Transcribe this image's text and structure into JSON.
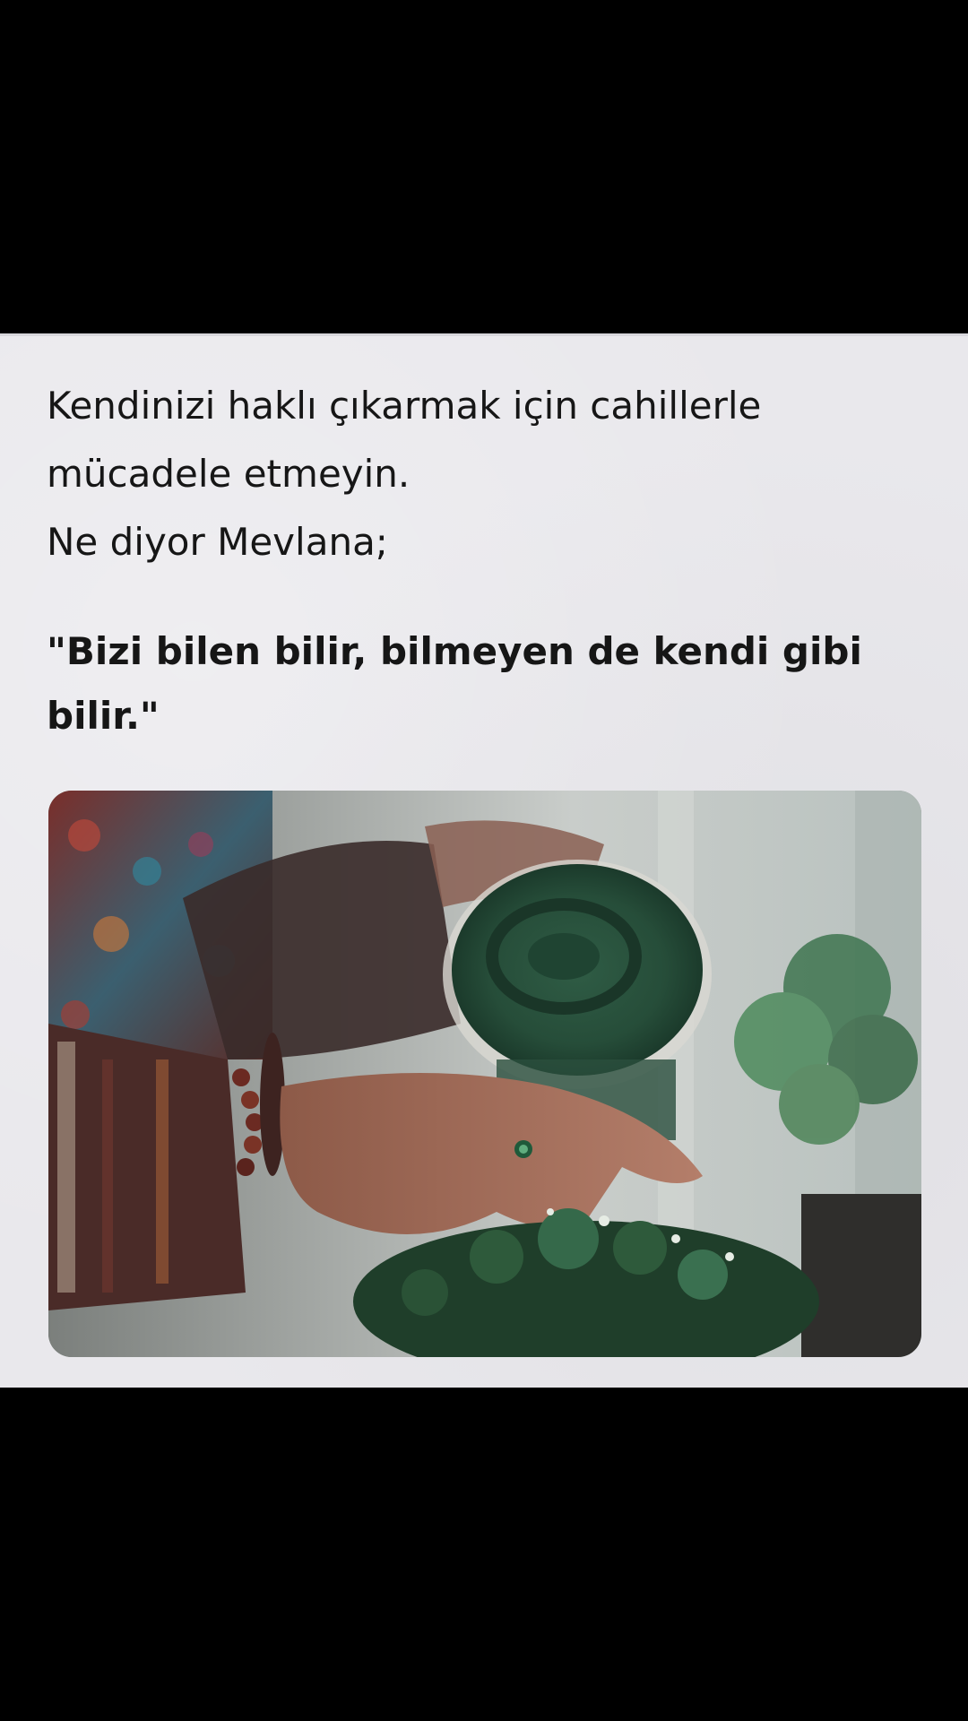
{
  "post": {
    "text_line_1": "Kendinizi haklı çıkarmak için cahillerle",
    "text_line_2": "mücadele etmeyin.",
    "text_line_3": "Ne diyor Mevlana;",
    "quote_line_1": "\"Bizi bilen bilir, bilmeyen de kendi gibi",
    "quote_line_2": "bilir.\""
  },
  "colors": {
    "background": "#000000",
    "card": "#e9e8ec",
    "text": "#161616"
  }
}
